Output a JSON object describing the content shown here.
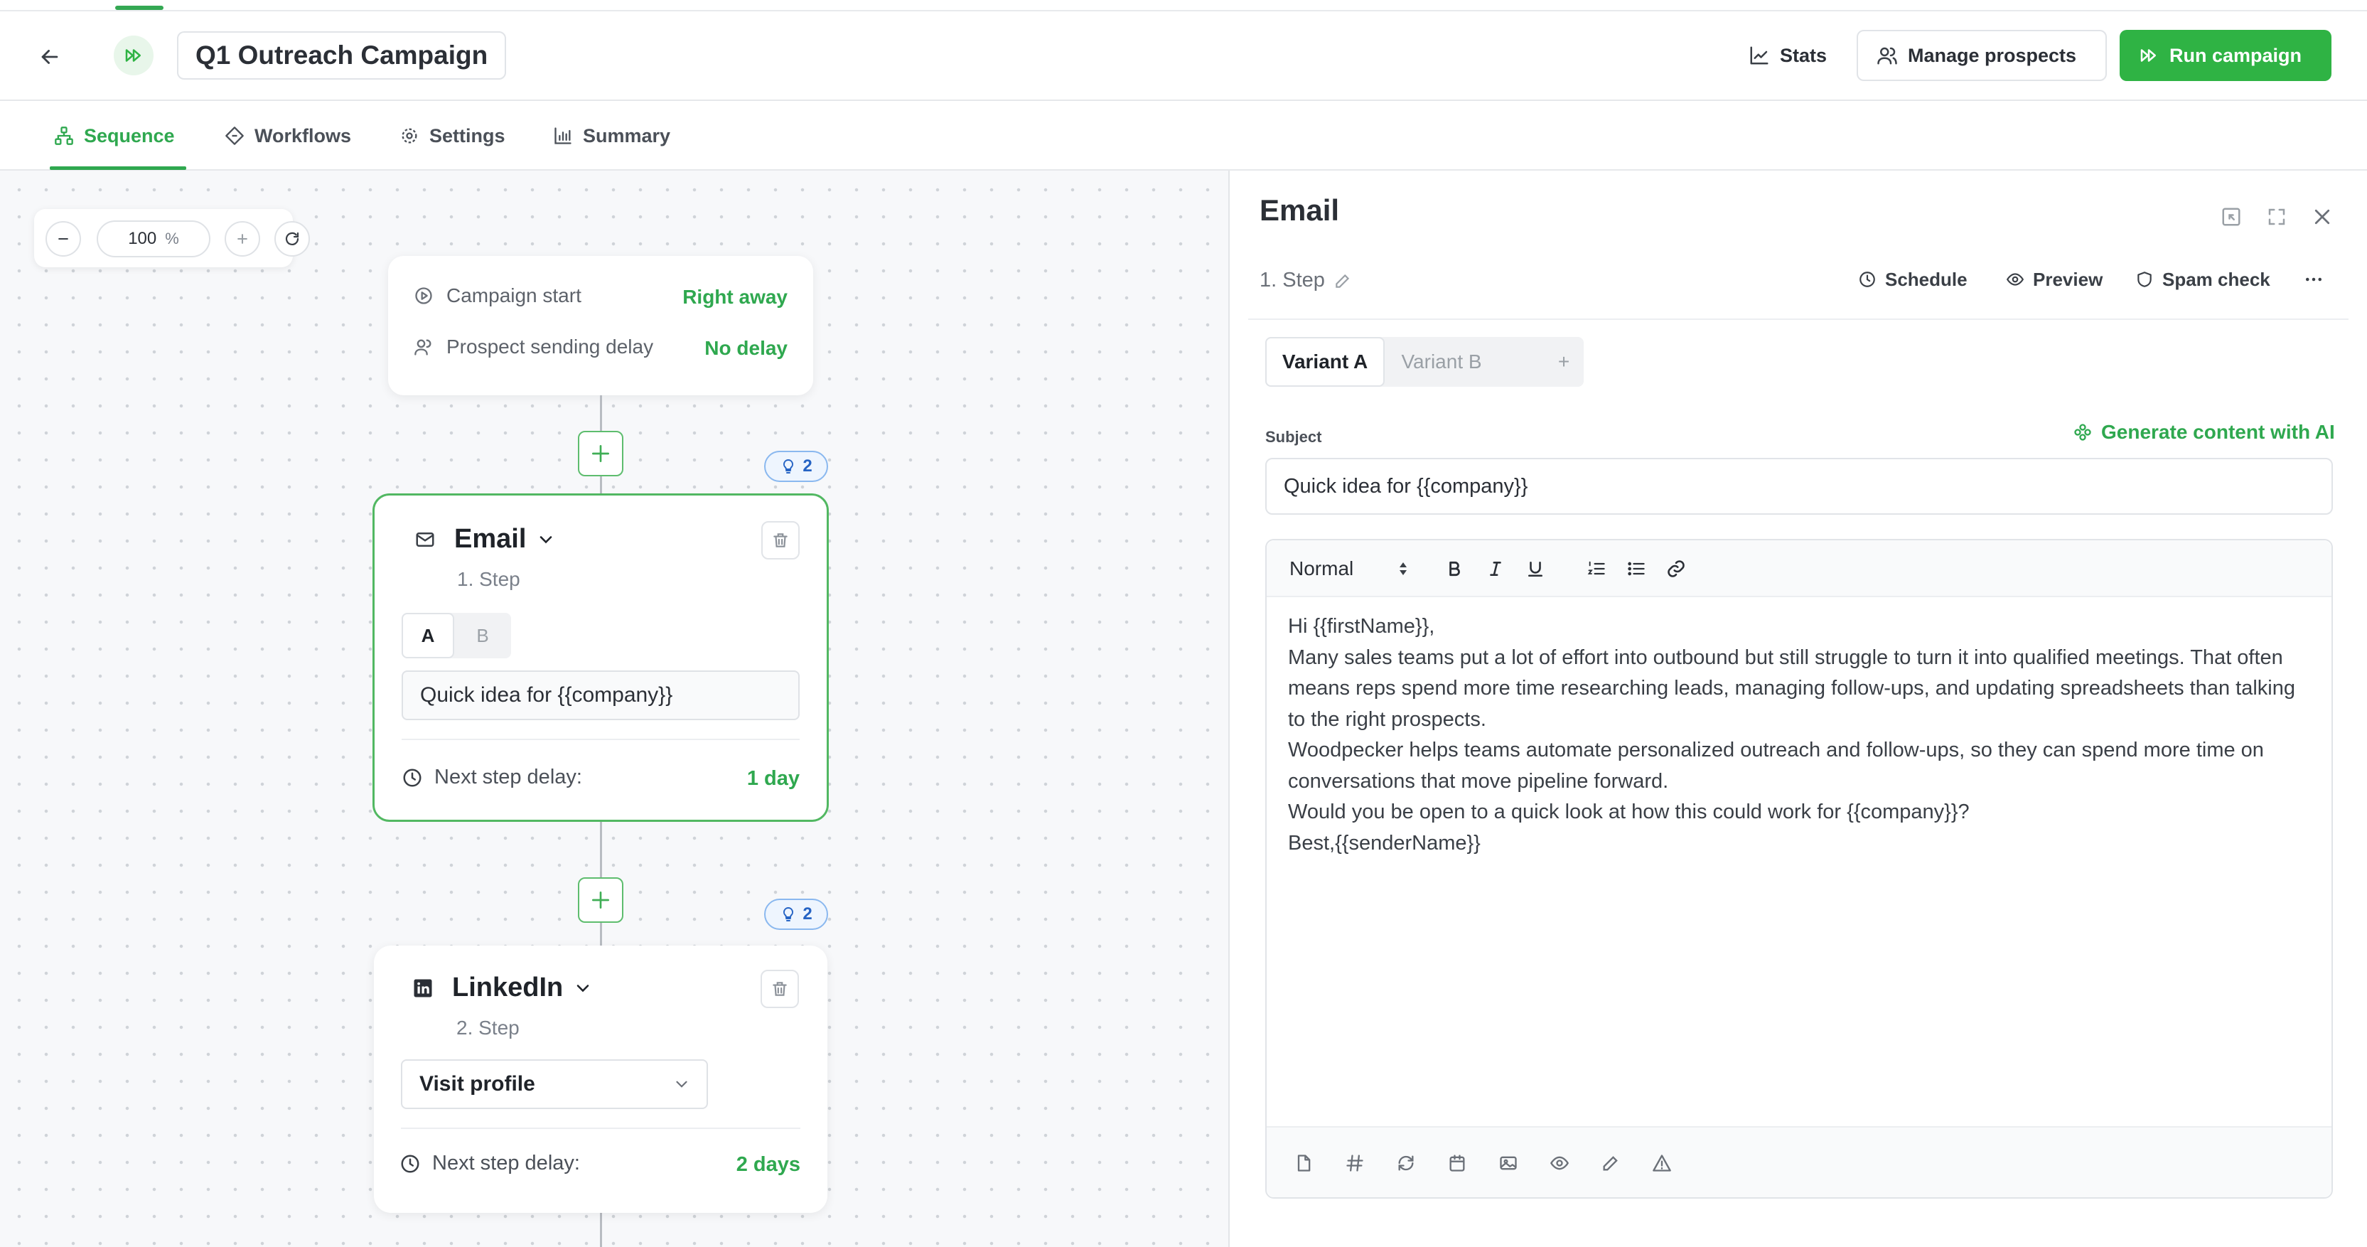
{
  "header": {
    "campaign_title": "Q1 Outreach Campaign",
    "stats_label": "Stats",
    "manage_label": "Manage prospects",
    "run_label": "Run campaign",
    "accent_color": "#2fb344"
  },
  "tabs": [
    {
      "label": "Sequence",
      "icon": "sequence-icon",
      "active": true
    },
    {
      "label": "Workflows",
      "icon": "workflows-icon"
    },
    {
      "label": "Settings",
      "icon": "gear-icon"
    },
    {
      "label": "Summary",
      "icon": "bar-chart-icon"
    }
  ],
  "canvas": {
    "zoom": "100",
    "zoom_unit": "%",
    "start_card": {
      "campaign_start_label": "Campaign start",
      "campaign_start_value": "Right away",
      "sending_delay_label": "Prospect sending delay",
      "sending_delay_value": "No delay"
    },
    "steps": [
      {
        "type": "Email",
        "sub": "1. Step",
        "hint_count": "2",
        "variant_a": "A",
        "variant_b": "B",
        "subject": "Quick idea for {{company}}",
        "delay_label": "Next step delay:",
        "delay_value": "1 day"
      },
      {
        "type": "LinkedIn",
        "sub": "2. Step",
        "hint_count": "2",
        "action": "Visit profile",
        "delay_label": "Next step delay:",
        "delay_value": "2 days"
      }
    ]
  },
  "panel": {
    "title": "Email",
    "step_label": "1. Step",
    "schedule_label": "Schedule",
    "preview_label": "Preview",
    "spam_label": "Spam check",
    "variant_a": "Variant A",
    "variant_b": "Variant B",
    "variant_add": "+",
    "subject_label": "Subject",
    "generate_label": "Generate content with AI",
    "subject_value": "Quick idea for {{company}}",
    "format_value": "Normal",
    "body_lines": [
      "Hi {{firstName}},",
      "Many sales teams put a lot of effort into outbound but still struggle to turn it into qualified meetings. That often means reps spend more time researching leads, managing follow-ups, and updating spreadsheets than talking to the right prospects.",
      "Woodpecker helps teams automate personalized outreach and follow-ups, so they can spend more time on conversations that move pipeline forward.",
      "Would you be open to a quick look at how this could work for {{company}}?",
      "Best,{{senderName}}"
    ]
  }
}
